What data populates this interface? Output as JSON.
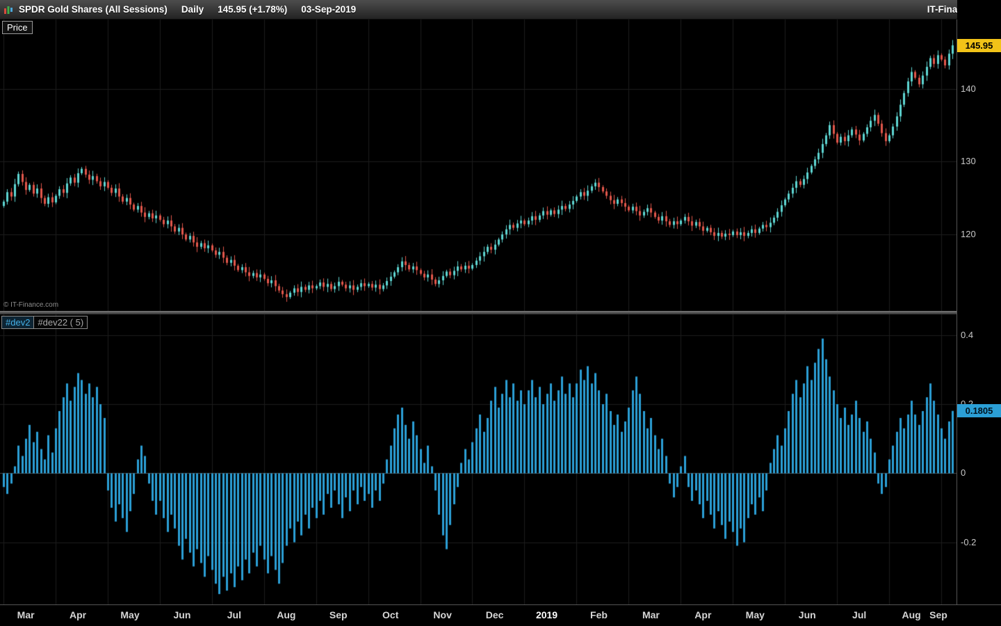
{
  "header": {
    "title": "SPDR Gold Shares (All Sessions)",
    "timeframe": "Daily",
    "last_change": "145.95 (+1.78%)",
    "date": "03-Sep-2019",
    "brand": "IT-Finance.com"
  },
  "price_pane": {
    "label": "Price",
    "watermark": "© IT-Finance.com",
    "last_price_tag": "145.95",
    "tag_color": "#f2c318",
    "up_color": "#5ed6d2",
    "down_color": "#e2574b"
  },
  "indicator_pane": {
    "name_active": "#dev2",
    "name_secondary": "#dev22 ( 5)",
    "last_value_tag": "0.1805",
    "bar_color": "#2b9fd6"
  },
  "x_axis": {
    "months": [
      "Mar",
      "Apr",
      "May",
      "Jun",
      "Jul",
      "Aug",
      "Sep",
      "Oct",
      "Nov",
      "Dec",
      "2019",
      "Feb",
      "Mar",
      "Apr",
      "May",
      "Jun",
      "Jul",
      "Aug",
      "Sep"
    ]
  },
  "chart_data": [
    {
      "type": "candlestick",
      "title": "SPDR Gold Shares (All Sessions) Daily",
      "ylabel": "Price",
      "ylim": [
        109.5,
        149.5
      ],
      "yticks": [
        140,
        130,
        120
      ],
      "last_close": 145.95,
      "close": [
        124.5,
        125.8,
        125.2,
        126.9,
        128.3,
        127.2,
        126.1,
        126.8,
        125.6,
        126.3,
        125.0,
        124.2,
        125.1,
        124.4,
        125.3,
        126.2,
        125.7,
        127.0,
        127.8,
        127.1,
        128.4,
        129.0,
        128.2,
        127.5,
        128.0,
        127.3,
        126.6,
        127.2,
        126.4,
        125.7,
        126.3,
        125.2,
        124.5,
        125.0,
        124.1,
        123.4,
        123.9,
        123.0,
        122.4,
        122.9,
        122.2,
        122.6,
        122.0,
        121.4,
        121.9,
        121.1,
        120.4,
        120.9,
        120.0,
        119.3,
        119.8,
        118.9,
        118.3,
        118.8,
        118.1,
        118.5,
        117.8,
        117.2,
        117.6,
        116.8,
        116.1,
        116.5,
        115.7,
        115.1,
        115.5,
        114.8,
        114.3,
        114.7,
        114.1,
        114.5,
        113.9,
        113.3,
        113.7,
        112.9,
        112.3,
        111.8,
        111.4,
        112.0,
        112.6,
        112.1,
        112.8,
        112.4,
        113.0,
        112.6,
        112.9,
        113.4,
        112.8,
        113.2,
        112.5,
        112.9,
        113.5,
        113.1,
        112.6,
        113.0,
        112.4,
        112.8,
        113.3,
        112.9,
        113.2,
        112.7,
        113.1,
        112.5,
        113.0,
        113.6,
        114.2,
        114.8,
        115.5,
        116.3,
        115.8,
        115.2,
        115.6,
        115.1,
        114.6,
        114.1,
        114.5,
        113.8,
        113.2,
        113.7,
        114.3,
        114.9,
        114.4,
        115.0,
        115.6,
        115.2,
        115.7,
        115.3,
        115.8,
        116.4,
        117.0,
        117.6,
        118.3,
        117.9,
        118.6,
        119.3,
        120.0,
        120.7,
        121.3,
        120.9,
        121.5,
        121.9,
        121.4,
        121.9,
        122.5,
        122.0,
        122.6,
        123.2,
        122.7,
        123.3,
        122.8,
        123.4,
        123.9,
        123.5,
        124.1,
        124.6,
        125.2,
        125.8,
        125.3,
        126.0,
        126.6,
        127.1,
        126.5,
        125.9,
        125.3,
        124.7,
        124.2,
        124.8,
        124.3,
        123.8,
        123.3,
        123.8,
        123.2,
        122.6,
        123.1,
        123.6,
        123.0,
        122.4,
        121.9,
        122.5,
        121.8,
        121.3,
        121.8,
        121.4,
        121.9,
        122.4,
        121.8,
        121.2,
        121.7,
        121.1,
        120.5,
        120.9,
        120.3,
        119.8,
        120.2,
        119.7,
        120.1,
        119.9,
        120.4,
        119.9,
        120.3,
        119.8,
        120.2,
        120.7,
        120.2,
        120.8,
        121.3,
        121.0,
        121.6,
        122.3,
        123.1,
        124.0,
        124.8,
        125.6,
        126.4,
        127.3,
        126.8,
        127.6,
        128.5,
        129.4,
        130.3,
        131.2,
        132.4,
        133.6,
        135.0,
        133.8,
        132.6,
        133.4,
        132.8,
        133.6,
        134.4,
        133.7,
        132.9,
        133.8,
        134.7,
        135.6,
        136.4,
        135.2,
        133.9,
        132.8,
        133.6,
        134.8,
        136.2,
        137.8,
        139.4,
        141.0,
        142.3,
        141.5,
        140.6,
        141.8,
        143.0,
        144.2,
        143.4,
        144.6,
        144.0,
        143.2,
        144.8,
        145.95
      ]
    },
    {
      "type": "bar",
      "title": "#dev2",
      "ylim": [
        -0.38,
        0.46
      ],
      "yticks": [
        0.4,
        0.2,
        0,
        -0.2
      ],
      "last_value": 0.1805,
      "values": [
        -0.04,
        -0.06,
        -0.03,
        0.02,
        0.08,
        0.05,
        0.1,
        0.14,
        0.09,
        0.12,
        0.07,
        0.04,
        0.11,
        0.06,
        0.13,
        0.18,
        0.22,
        0.26,
        0.21,
        0.25,
        0.29,
        0.27,
        0.23,
        0.26,
        0.22,
        0.25,
        0.2,
        0.16,
        -0.05,
        -0.1,
        -0.14,
        -0.09,
        -0.13,
        -0.17,
        -0.11,
        -0.06,
        0.04,
        0.08,
        0.05,
        -0.03,
        -0.08,
        -0.12,
        -0.08,
        -0.13,
        -0.17,
        -0.12,
        -0.16,
        -0.21,
        -0.25,
        -0.19,
        -0.23,
        -0.27,
        -0.22,
        -0.26,
        -0.3,
        -0.24,
        -0.28,
        -0.32,
        -0.35,
        -0.3,
        -0.34,
        -0.29,
        -0.33,
        -0.27,
        -0.31,
        -0.25,
        -0.29,
        -0.23,
        -0.27,
        -0.21,
        -0.25,
        -0.29,
        -0.24,
        -0.28,
        -0.32,
        -0.26,
        -0.21,
        -0.16,
        -0.2,
        -0.14,
        -0.18,
        -0.12,
        -0.16,
        -0.1,
        -0.13,
        -0.08,
        -0.12,
        -0.06,
        -0.1,
        -0.05,
        -0.09,
        -0.13,
        -0.07,
        -0.11,
        -0.05,
        -0.09,
        -0.04,
        -0.08,
        -0.06,
        -0.1,
        -0.05,
        -0.08,
        -0.03,
        0.04,
        0.08,
        0.13,
        0.17,
        0.19,
        0.14,
        0.1,
        0.15,
        0.11,
        0.07,
        0.03,
        0.08,
        0.02,
        -0.05,
        -0.12,
        -0.18,
        -0.22,
        -0.15,
        -0.09,
        -0.04,
        0.03,
        0.07,
        0.04,
        0.09,
        0.13,
        0.17,
        0.12,
        0.16,
        0.21,
        0.25,
        0.19,
        0.23,
        0.27,
        0.22,
        0.26,
        0.21,
        0.24,
        0.2,
        0.24,
        0.27,
        0.22,
        0.25,
        0.2,
        0.23,
        0.26,
        0.21,
        0.24,
        0.28,
        0.23,
        0.26,
        0.22,
        0.26,
        0.3,
        0.27,
        0.31,
        0.26,
        0.29,
        0.24,
        0.2,
        0.23,
        0.18,
        0.14,
        0.17,
        0.12,
        0.15,
        0.19,
        0.24,
        0.28,
        0.23,
        0.18,
        0.13,
        0.16,
        0.11,
        0.07,
        0.1,
        0.05,
        -0.03,
        -0.07,
        -0.04,
        0.02,
        0.05,
        -0.04,
        -0.08,
        -0.05,
        -0.09,
        -0.13,
        -0.08,
        -0.12,
        -0.16,
        -0.11,
        -0.15,
        -0.19,
        -0.14,
        -0.17,
        -0.21,
        -0.16,
        -0.2,
        -0.13,
        -0.09,
        -0.12,
        -0.07,
        -0.11,
        -0.05,
        0.03,
        0.07,
        0.11,
        0.08,
        0.13,
        0.18,
        0.23,
        0.27,
        0.22,
        0.26,
        0.31,
        0.27,
        0.32,
        0.36,
        0.39,
        0.33,
        0.28,
        0.24,
        0.2,
        0.16,
        0.19,
        0.14,
        0.17,
        0.21,
        0.16,
        0.12,
        0.15,
        0.1,
        0.06,
        -0.03,
        -0.06,
        -0.04,
        0.04,
        0.08,
        0.12,
        0.16,
        0.13,
        0.17,
        0.21,
        0.17,
        0.14,
        0.18,
        0.22,
        0.26,
        0.21,
        0.17,
        0.13,
        0.1,
        0.15,
        0.1805
      ]
    }
  ]
}
